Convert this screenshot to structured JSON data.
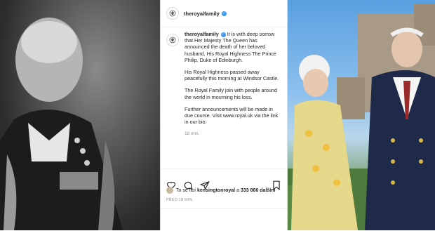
{
  "post": {
    "username": "theroyalfamily",
    "caption_username": "theroyalfamily",
    "caption_p1": "It is with deep sorrow that Her Majesty The Queen has announced the death of her beloved husband, His Royal Highness The Prince Philip, Duke of Edinburgh.",
    "caption_p2": "His Royal Highness passed away peacefully this morning at Windsor Castle.",
    "caption_p3": "The Royal Family join with people around the world in mourning his loss.",
    "caption_p4": "Further announcements will be made in due course. Visit www.royal.uk via the link in our bio.",
    "time_ago": "18 min.",
    "likes_prefix": "To se líbí",
    "likes_user": "kensingtonroyal",
    "likes_mid": "a",
    "likes_count": "333 866 dalším",
    "posted": "PŘED 18 MIN."
  },
  "colors": {
    "verified": "#3897f0",
    "text": "#262626",
    "muted": "#8e8e8e"
  },
  "icons": [
    "crest-icon",
    "verified-icon",
    "heart-icon",
    "comment-icon",
    "share-icon",
    "bookmark-icon"
  ]
}
